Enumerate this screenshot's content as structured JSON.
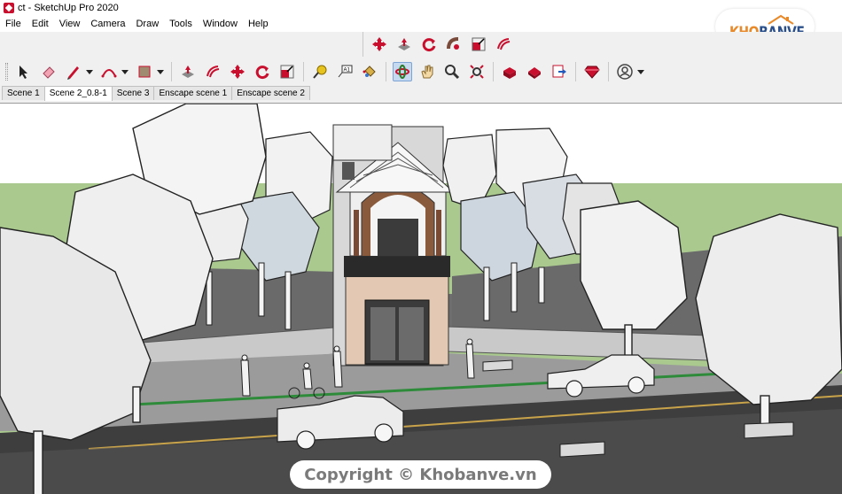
{
  "window": {
    "title": "ct - SketchUp Pro 2020"
  },
  "menu": [
    "File",
    "Edit",
    "View",
    "Camera",
    "Draw",
    "Tools",
    "Window",
    "Help"
  ],
  "toolbar_top": [
    {
      "icon": "move-icon"
    },
    {
      "icon": "push-pull-icon"
    },
    {
      "icon": "rotate-icon"
    },
    {
      "icon": "follow-me-icon"
    },
    {
      "icon": "scale-icon"
    },
    {
      "icon": "offset-icon"
    }
  ],
  "toolbar_main": [
    {
      "icon": "select-arrow-icon"
    },
    {
      "icon": "eraser-icon"
    },
    {
      "icon": "pencil-line-icon",
      "dropdown": true
    },
    {
      "icon": "arc-icon",
      "dropdown": true
    },
    {
      "icon": "rectangle-icon",
      "dropdown": true
    },
    {
      "icon": "push-pull-icon"
    },
    {
      "icon": "offset-icon"
    },
    {
      "icon": "move-icon"
    },
    {
      "icon": "rotate-icon"
    },
    {
      "icon": "scale-icon"
    },
    {
      "icon": "tape-measure-icon"
    },
    {
      "icon": "text-label-icon"
    },
    {
      "icon": "paint-bucket-icon"
    },
    {
      "icon": "orbit-icon",
      "active": true
    },
    {
      "icon": "pan-hand-icon"
    },
    {
      "icon": "zoom-icon"
    },
    {
      "icon": "zoom-extents-icon"
    },
    {
      "icon": "3d-warehouse-icon"
    },
    {
      "icon": "extension-warehouse-icon"
    },
    {
      "icon": "layout-send-icon"
    },
    {
      "icon": "ruby-extension-icon"
    },
    {
      "icon": "user-account-icon",
      "dropdown": true
    }
  ],
  "scene_tabs": [
    {
      "label": "Scene 1",
      "active": false
    },
    {
      "label": "Scene 2_0.8-1",
      "active": true
    },
    {
      "label": "Scene 3",
      "active": false
    },
    {
      "label": "Enscape scene 1",
      "active": false
    },
    {
      "label": "Enscape scene 2",
      "active": false
    }
  ],
  "logo": {
    "part1": "KHO",
    "part2": "BANVE"
  },
  "copyright": "Copyright © Khobanve.vn",
  "colors": {
    "sky": "#ffffff",
    "grass": "#a9c98f",
    "ground": "#5f5f5f",
    "road": "#3f3f3f",
    "wall": "#c8c8c8",
    "accent": "#c8102e",
    "logo_orange": "#e8892a",
    "logo_blue": "#2a4f8a"
  }
}
